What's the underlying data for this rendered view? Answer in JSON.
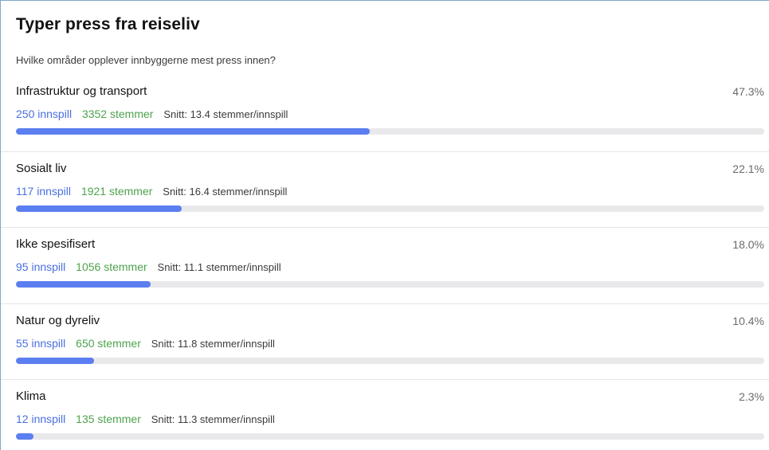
{
  "panel": {
    "title": "Typer press fra reiseliv",
    "subtitle": "Hvilke områder opplever innbyggerne mest press innen?"
  },
  "colors": {
    "innspill": "#4a6fe0",
    "stemmer": "#4ea24e",
    "bar_fill": "#5b7ef0",
    "bar_track": "#e9e9ec"
  },
  "categories": [
    {
      "name": "Infrastruktur og transport",
      "percent_label": "47.3%",
      "percent": 47.3,
      "innspill": "250 innspill",
      "stemmer": "3352 stemmer",
      "snitt": "Snitt: 13.4 stemmer/innspill"
    },
    {
      "name": "Sosialt liv",
      "percent_label": "22.1%",
      "percent": 22.1,
      "innspill": "117 innspill",
      "stemmer": "1921 stemmer",
      "snitt": "Snitt: 16.4 stemmer/innspill"
    },
    {
      "name": "Ikke spesifisert",
      "percent_label": "18.0%",
      "percent": 18.0,
      "innspill": "95 innspill",
      "stemmer": "1056 stemmer",
      "snitt": "Snitt: 11.1 stemmer/innspill"
    },
    {
      "name": "Natur og dyreliv",
      "percent_label": "10.4%",
      "percent": 10.4,
      "innspill": "55 innspill",
      "stemmer": "650 stemmer",
      "snitt": "Snitt: 11.8 stemmer/innspill"
    },
    {
      "name": "Klima",
      "percent_label": "2.3%",
      "percent": 2.3,
      "innspill": "12 innspill",
      "stemmer": "135 stemmer",
      "snitt": "Snitt: 11.3 stemmer/innspill"
    }
  ]
}
